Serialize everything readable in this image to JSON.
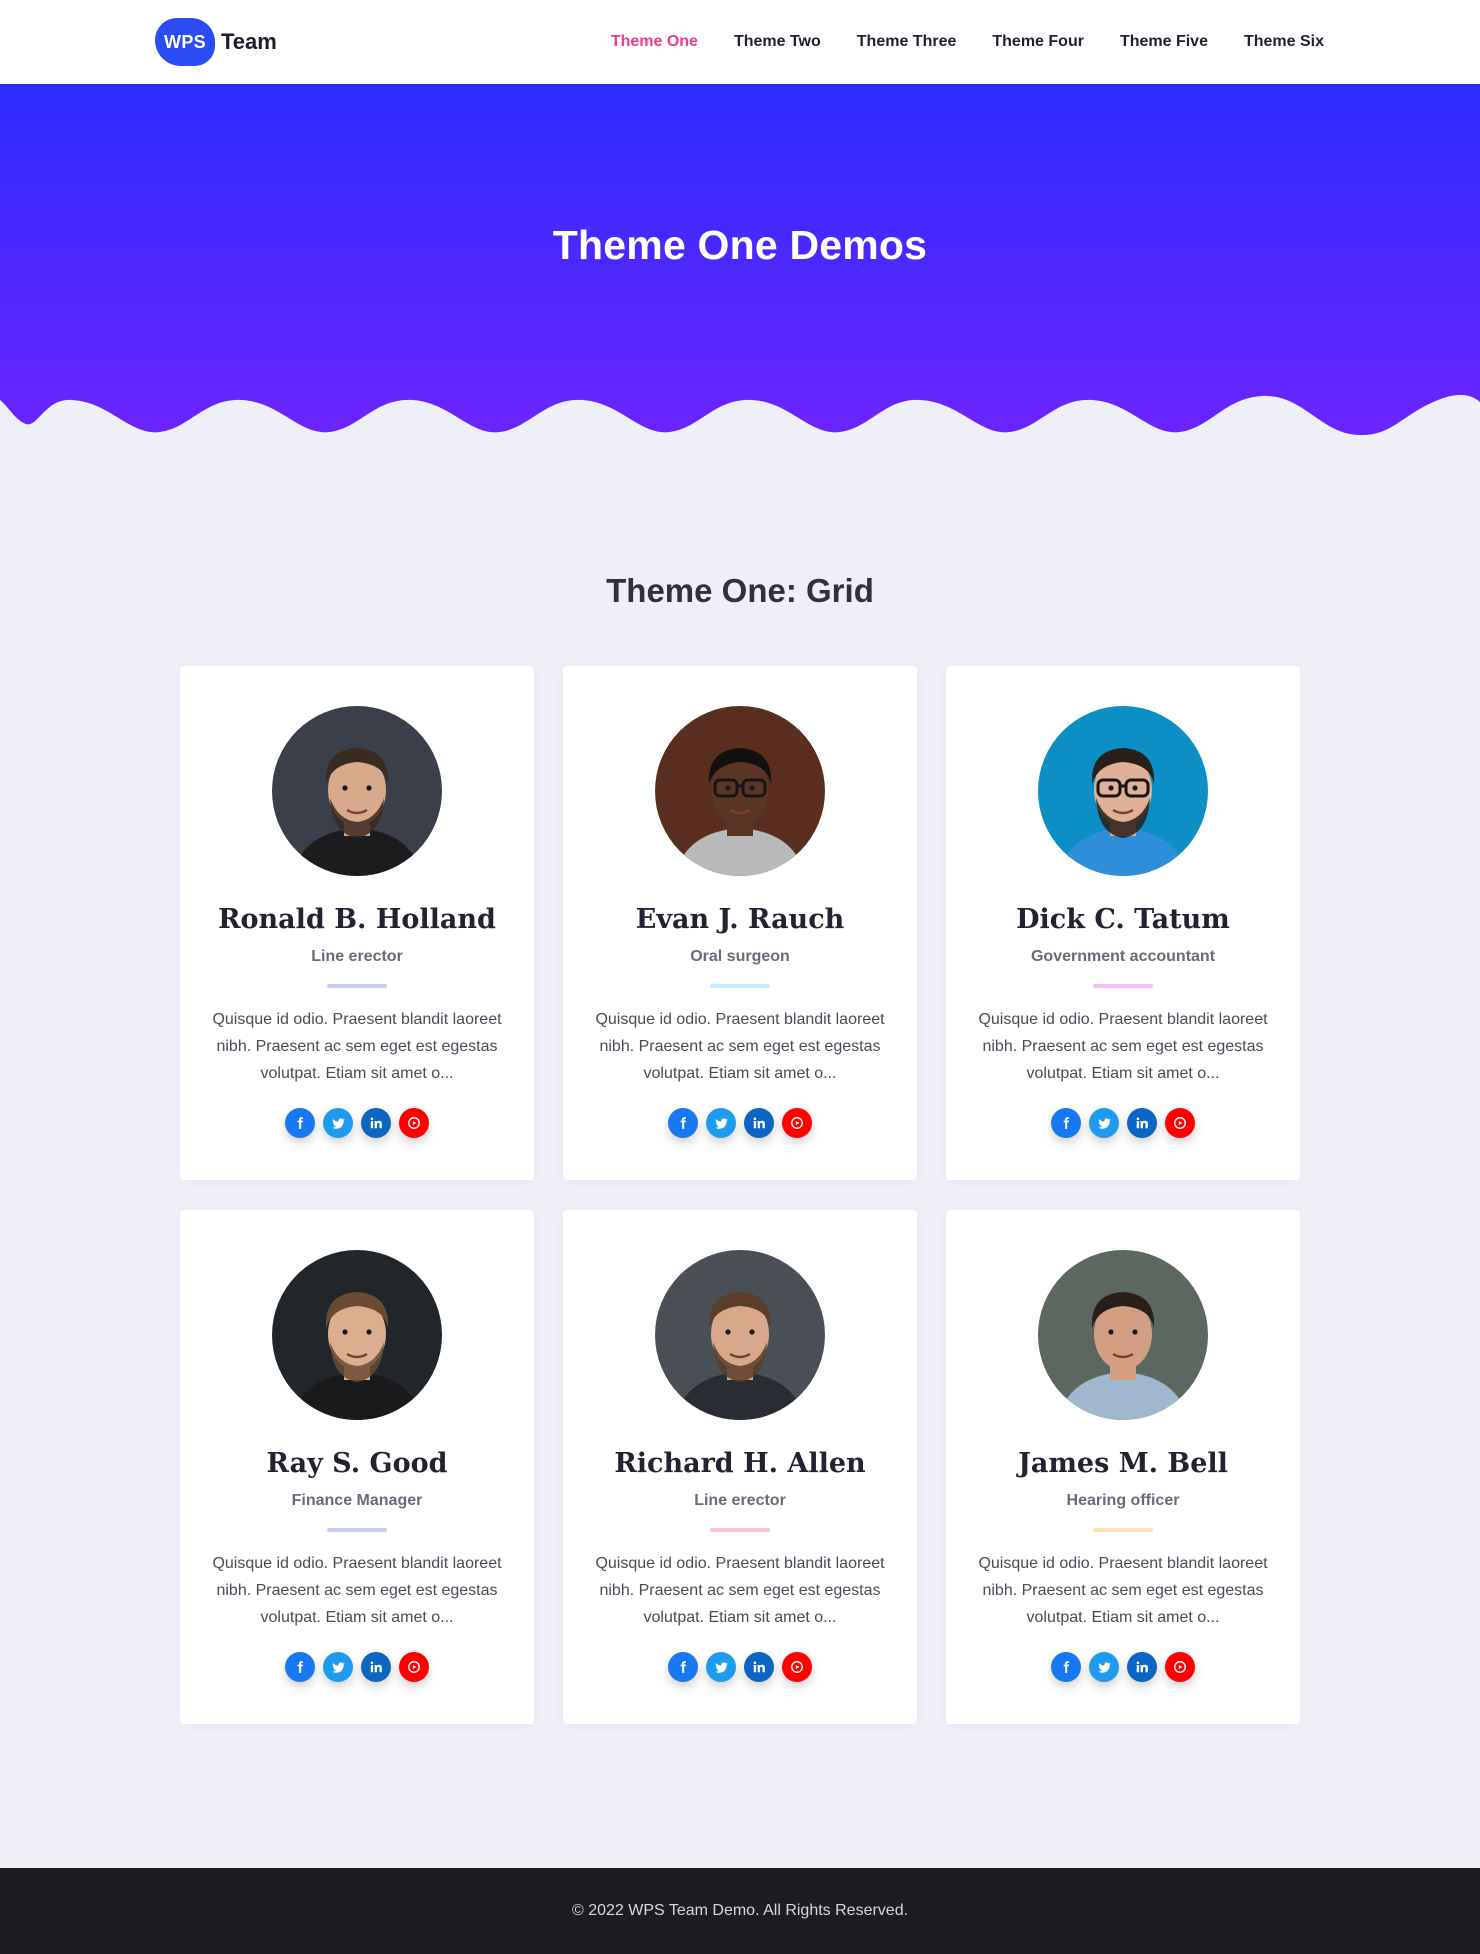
{
  "header": {
    "logo_badge": "WPS",
    "logo_text": "Team",
    "nav": [
      {
        "label": "Theme One",
        "active": true
      },
      {
        "label": "Theme Two"
      },
      {
        "label": "Theme Three"
      },
      {
        "label": "Theme Four"
      },
      {
        "label": "Theme Five"
      },
      {
        "label": "Theme Six"
      }
    ]
  },
  "hero": {
    "title": "Theme One Demos",
    "gradient_top": "#2c2cff",
    "gradient_bottom": "#6c24ff"
  },
  "section": {
    "title": "Theme One: Grid"
  },
  "members": [
    {
      "name": "Ronald B. Holland",
      "role": "Line erector",
      "bio": "Quisque id odio. Praesent blandit laoreet nibh. Praesent ac sem eget est egestas volutpat. Etiam sit amet o...",
      "accent": "#c4cbf3",
      "photo": {
        "bg": "#3a3f4a",
        "skin": "#d8a98a",
        "hair": "#3b2a20",
        "shirt": "#1c1c1f",
        "beard": true,
        "glasses": false
      }
    },
    {
      "name": "Evan J. Rauch",
      "role": "Oral surgeon",
      "bio": "Quisque id odio. Praesent blandit laoreet nibh. Praesent ac sem eget est egestas volutpat. Etiam sit amet o...",
      "accent": "#c6eefc",
      "photo": {
        "bg": "#5a2e1e",
        "skin": "#5a3524",
        "hair": "#151010",
        "shirt": "#b9b9b9",
        "beard": false,
        "glasses": true
      }
    },
    {
      "name": "Dick C. Tatum",
      "role": "Government accountant",
      "bio": "Quisque id odio. Praesent blandit laoreet nibh. Praesent ac sem eget est egestas volutpat. Etiam sit amet o...",
      "accent": "#ecc3f2",
      "photo": {
        "bg": "#0c8fc4",
        "skin": "#e0b097",
        "hair": "#2a1e18",
        "shirt": "#2f8ed9",
        "beard": true,
        "glasses": true
      }
    },
    {
      "name": "Ray S. Good",
      "role": "Finance Manager",
      "bio": "Quisque id odio. Praesent blandit laoreet nibh. Praesent ac sem eget est egestas volutpat. Etiam sit amet o...",
      "accent": "#c4cbf3",
      "photo": {
        "bg": "#20262a",
        "skin": "#dcae8f",
        "hair": "#6b4a32",
        "shirt": "#1a1a1c",
        "beard": true,
        "glasses": false
      }
    },
    {
      "name": "Richard H. Allen",
      "role": "Line erector",
      "bio": "Quisque id odio. Praesent blandit laoreet nibh. Praesent ac sem eget est egestas volutpat. Etiam sit amet o...",
      "accent": "#f8c2d4",
      "photo": {
        "bg": "#4a4f55",
        "skin": "#d9a88a",
        "hair": "#5b3d2a",
        "shirt": "#2a2c33",
        "beard": true,
        "glasses": false
      }
    },
    {
      "name": "James M. Bell",
      "role": "Hearing officer",
      "bio": "Quisque id odio. Praesent blandit laoreet nibh. Praesent ac sem eget est egestas volutpat. Etiam sit amet o...",
      "accent": "#fde3b8",
      "photo": {
        "bg": "#5c6760",
        "skin": "#d29f82",
        "hair": "#2a1f18",
        "shirt": "#9fb8cf",
        "beard": false,
        "glasses": false
      }
    }
  ],
  "social_icons": [
    "facebook-icon",
    "twitter-icon",
    "linkedin-icon",
    "youtube-icon"
  ],
  "footer": {
    "copyright": "© 2022 WPS Team Demo. All Rights Reserved."
  }
}
